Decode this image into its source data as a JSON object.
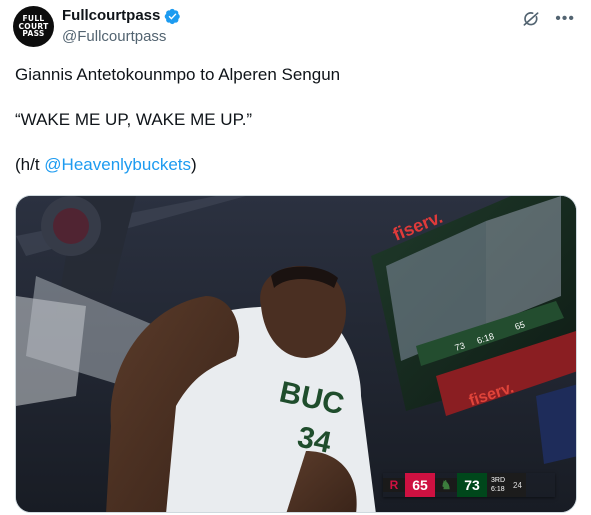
{
  "author": {
    "display_name": "Fullcourtpass",
    "handle": "@Fullcourtpass",
    "avatar_lines": [
      "FULL",
      "COURT",
      "PASS"
    ],
    "verified": true
  },
  "icons": {
    "grok": "grok-icon",
    "more": "more-icon",
    "verified": "verified-badge-icon"
  },
  "tweet": {
    "line1": "Giannis Antetokounmpo to Alperen Sengun",
    "line2": "“WAKE ME UP, WAKE ME UP.”",
    "line3_prefix": "(h/t ",
    "line3_mention": "@Heavenlybuckets",
    "line3_suffix": ")"
  },
  "media": {
    "jersey_text": "BUC",
    "jersey_number": "34",
    "arena_sign": "fiserv.",
    "board_score": "73",
    "board_clock": "6:18",
    "board_other": "65",
    "scorebug": {
      "home_score": "65",
      "away_score": "73",
      "period": "3RD",
      "clock": "6:18",
      "shot_clock": "24"
    }
  },
  "colors": {
    "link": "#1d9bf0",
    "verified": "#1d9bf0",
    "rockets_red": "#ce1141",
    "bucks_green": "#00471b"
  }
}
